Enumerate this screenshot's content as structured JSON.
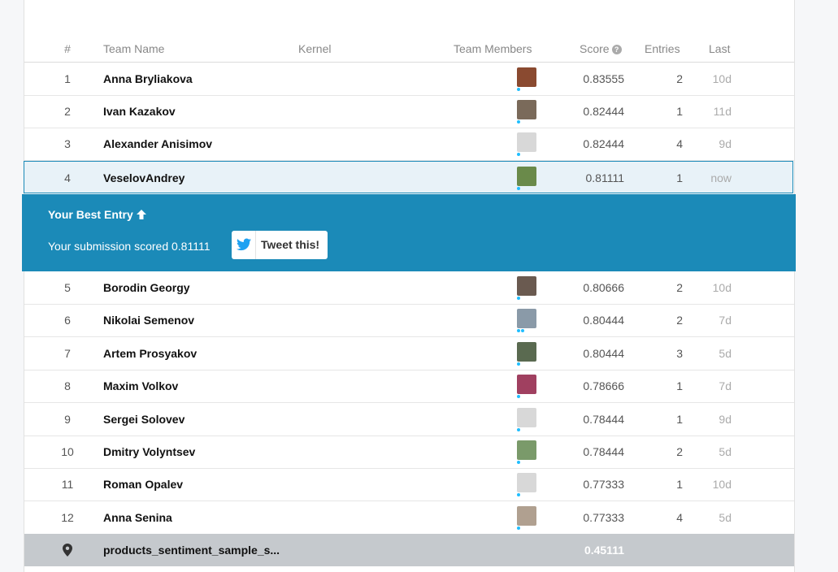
{
  "header": {
    "rank": "#",
    "team_name": "Team Name",
    "kernel": "Kernel",
    "team_members": "Team Members",
    "score": "Score",
    "entries": "Entries",
    "last": "Last",
    "score_help_icon": "question-circle-icon"
  },
  "rows_top": [
    {
      "rank": "1",
      "team": "Anna Bryliakova",
      "score": "0.83555",
      "entries": "2",
      "last": "10d",
      "avatar_color": "#8a4a30",
      "dots": 1
    },
    {
      "rank": "2",
      "team": "Ivan Kazakov",
      "score": "0.82444",
      "entries": "1",
      "last": "11d",
      "avatar_color": "#7a6a5a",
      "dots": 1
    },
    {
      "rank": "3",
      "team": "Alexander Anisimov",
      "score": "0.82444",
      "entries": "4",
      "last": "9d",
      "avatar_color": "#d8d8d8",
      "dots": 1
    }
  ],
  "highlight_row": {
    "rank": "4",
    "team": "VeselovAndrey",
    "score": "0.81111",
    "entries": "1",
    "last": "now",
    "avatar_color": "#6a8a4a",
    "dots": 1
  },
  "best_entry": {
    "title": "Your Best Entry",
    "title_icon": "arrow-up-icon",
    "text": "Your submission scored 0.81111",
    "tweet_label": "Tweet this!",
    "tweet_icon": "twitter-icon",
    "bg_color": "#1b8ab8"
  },
  "rows_bottom": [
    {
      "rank": "5",
      "team": "Borodin Georgy",
      "score": "0.80666",
      "entries": "2",
      "last": "10d",
      "avatar_color": "#6a5a50",
      "dots": 1
    },
    {
      "rank": "6",
      "team": "Nikolai Semenov",
      "score": "0.80444",
      "entries": "2",
      "last": "7d",
      "avatar_color": "#8a9aa8",
      "dots": 2
    },
    {
      "rank": "7",
      "team": "Artem Prosyakov",
      "score": "0.80444",
      "entries": "3",
      "last": "5d",
      "avatar_color": "#5a6a50",
      "dots": 1
    },
    {
      "rank": "8",
      "team": "Maxim Volkov",
      "score": "0.78666",
      "entries": "1",
      "last": "7d",
      "avatar_color": "#a04060",
      "dots": 1
    },
    {
      "rank": "9",
      "team": "Sergei Solovev",
      "score": "0.78444",
      "entries": "1",
      "last": "9d",
      "avatar_color": "#d8d8d8",
      "dots": 1
    },
    {
      "rank": "10",
      "team": "Dmitry Volyntsev",
      "score": "0.78444",
      "entries": "2",
      "last": "5d",
      "avatar_color": "#7a9a6a",
      "dots": 1
    },
    {
      "rank": "11",
      "team": "Roman Opalev",
      "score": "0.77333",
      "entries": "1",
      "last": "10d",
      "avatar_color": "#d8d8d8",
      "dots": 1
    },
    {
      "rank": "12",
      "team": "Anna Senina",
      "score": "0.77333",
      "entries": "4",
      "last": "5d",
      "avatar_color": "#b0a090",
      "dots": 1
    }
  ],
  "benchmark": {
    "icon": "map-pin-icon",
    "team": "products_sentiment_sample_s...",
    "score": "0.45111"
  }
}
